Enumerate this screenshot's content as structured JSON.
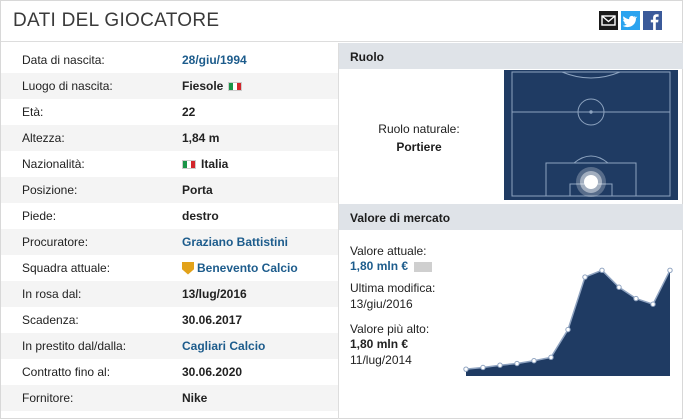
{
  "header": {
    "title": "DATI DEL GIOCATORE",
    "icons": [
      "email-icon",
      "twitter-icon",
      "facebook-icon"
    ]
  },
  "details": [
    {
      "label": "Data di nascita:",
      "value": "28/giu/1994",
      "link": true
    },
    {
      "label": "Luogo di nascita:",
      "value": "Fiesole",
      "flag_after": "italy"
    },
    {
      "label": "Età:",
      "value": "22"
    },
    {
      "label": "Altezza:",
      "value": "1,84 m"
    },
    {
      "label": "Nazionalità:",
      "value": "Italia",
      "flag_before": "italy"
    },
    {
      "label": "Posizione:",
      "value": "Porta"
    },
    {
      "label": "Piede:",
      "value": "destro"
    },
    {
      "label": "Procuratore:",
      "value": "Graziano Battistini",
      "link": true
    },
    {
      "label": "Squadra attuale:",
      "value": "Benevento Calcio",
      "link": true,
      "crest": true
    },
    {
      "label": "In rosa dal:",
      "value": "13/lug/2016"
    },
    {
      "label": "Scadenza:",
      "value": "30.06.2017"
    },
    {
      "label": "In prestito dal/dalla:",
      "value": "Cagliari Calcio",
      "link": true
    },
    {
      "label": "Contratto fino al:",
      "value": "30.06.2020"
    },
    {
      "label": "Fornitore:",
      "value": "Nike"
    }
  ],
  "ruolo": {
    "heading": "Ruolo",
    "label": "Ruolo naturale:",
    "value": "Portiere",
    "colors": {
      "pitch": "#1f3b63",
      "lines": "#8da3bf"
    }
  },
  "market": {
    "heading": "Valore di mercato",
    "current_label": "Valore attuale:",
    "current_value": "1,80 mln €",
    "last_mod_label": "Ultima modifica:",
    "last_mod_value": "13/giu/2016",
    "highest_label": "Valore più alto:",
    "highest_value": "1,80 mln €",
    "highest_date": "11/lug/2014",
    "colors": {
      "area": "#1f3b63",
      "line": "#8fa3c0"
    }
  },
  "chart_data": {
    "type": "area",
    "title": "",
    "xlabel": "",
    "ylabel": "",
    "points": [
      0.05,
      0.08,
      0.12,
      0.15,
      0.2,
      0.26,
      0.75,
      1.68,
      1.8,
      1.5,
      1.3,
      1.2,
      1.8
    ],
    "ylim": [
      0,
      2.0
    ],
    "grid": false
  }
}
